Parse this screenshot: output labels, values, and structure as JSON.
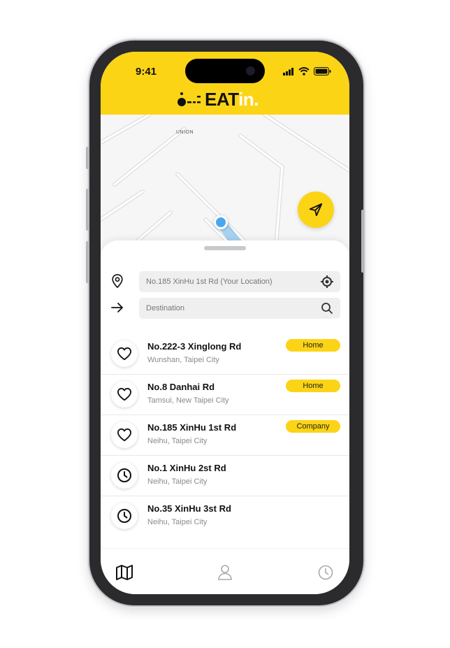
{
  "status_bar": {
    "time": "9:41"
  },
  "brand": {
    "logo_main": "EAT",
    "logo_accent": "in."
  },
  "colors": {
    "brand_yellow": "#fcd416",
    "location_blue": "#4aa7ee",
    "text_dark": "#111111",
    "text_muted": "#8a8a8a"
  },
  "map": {
    "labels": [
      "UNION"
    ]
  },
  "search": {
    "origin_value": "No.185 XinHu 1st Rd (Your Location)",
    "destination_placeholder": "Destination"
  },
  "places": [
    {
      "title": "No.222-3 Xinglong Rd",
      "subtitle": "Wunshan, Taipei City",
      "badge": "Home",
      "icon": "heart-icon"
    },
    {
      "title": "No.8 Danhai Rd",
      "subtitle": "Tamsui, New Taipei City",
      "badge": "Home",
      "icon": "heart-icon"
    },
    {
      "title": "No.185 XinHu 1st Rd",
      "subtitle": "Neihu, Taipei City",
      "badge": "Company",
      "icon": "heart-icon"
    },
    {
      "title": "No.1 XinHu 2st Rd",
      "subtitle": "Neihu, Taipei City",
      "badge": "",
      "icon": "clock-icon"
    },
    {
      "title": "No.35 XinHu 3st Rd",
      "subtitle": "Neihu, Taipei City",
      "badge": "",
      "icon": "clock-icon"
    }
  ],
  "tabs": [
    {
      "name": "map",
      "icon": "map-icon",
      "active": true
    },
    {
      "name": "profile",
      "icon": "user-icon",
      "active": false
    },
    {
      "name": "history",
      "icon": "clock-icon",
      "active": false
    }
  ]
}
